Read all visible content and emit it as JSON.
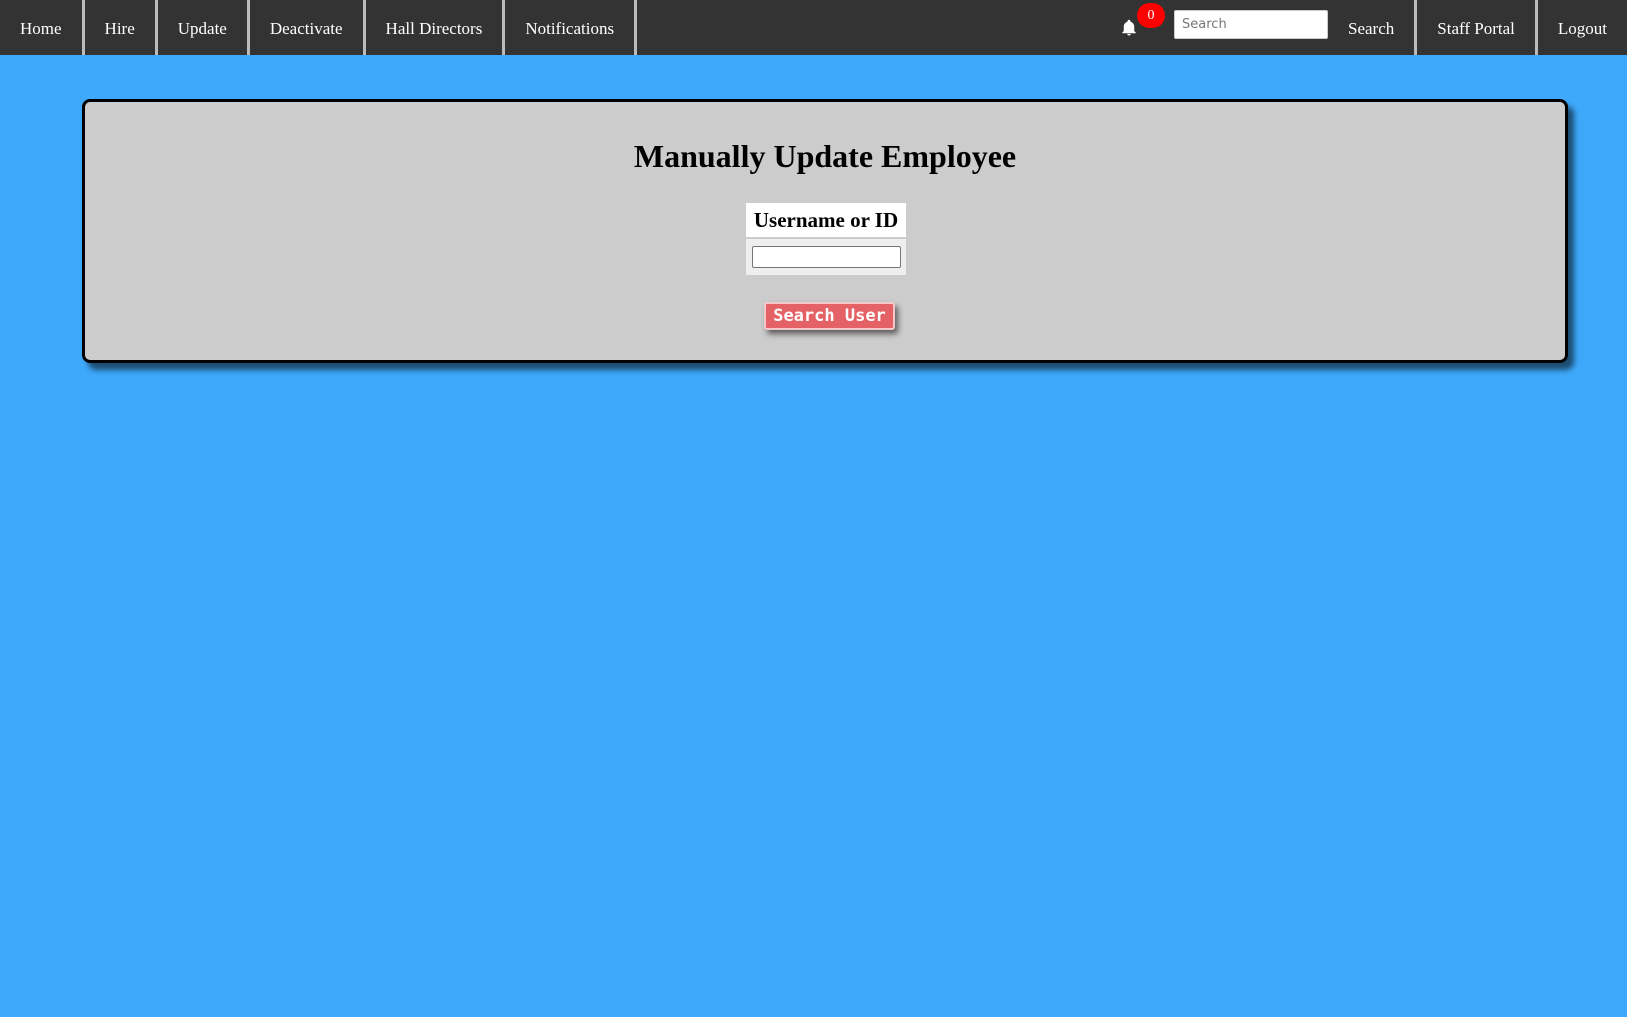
{
  "nav": {
    "left_items": [
      {
        "label": "Home"
      },
      {
        "label": "Hire"
      },
      {
        "label": "Update"
      },
      {
        "label": "Deactivate"
      },
      {
        "label": "Hall Directors"
      },
      {
        "label": "Notifications"
      }
    ],
    "notifications": {
      "icon": "bell-icon",
      "count": "0",
      "badge_color": "#ff0000"
    },
    "search": {
      "placeholder": "Search",
      "value": "",
      "button_label": "Search"
    },
    "right_items": [
      {
        "label": "Staff Portal"
      },
      {
        "label": "Logout"
      }
    ]
  },
  "panel": {
    "title": "Manually Update Employee",
    "field_label": "Username or ID",
    "field_value": "",
    "submit_label": "Search User"
  },
  "colors": {
    "background": "#3ea9fb",
    "nav_bar": "#333333",
    "panel": "#cccccc",
    "submit_button": "#e46266"
  }
}
